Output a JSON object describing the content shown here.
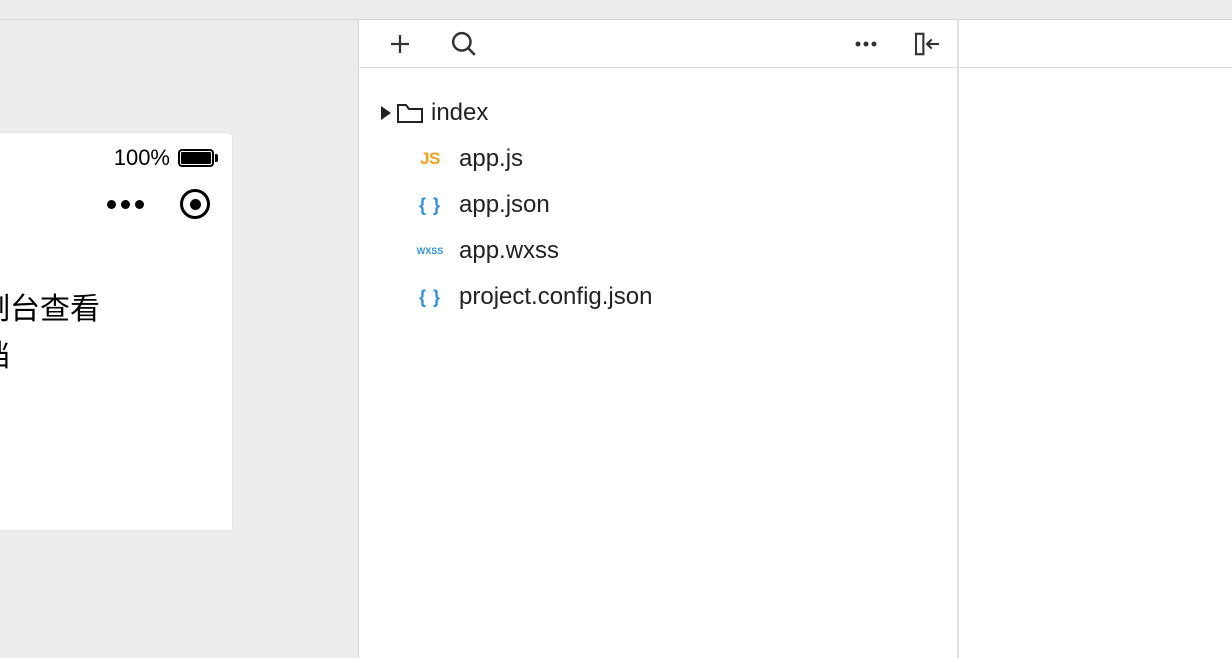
{
  "simulator": {
    "battery_percent": "100%",
    "content_line1": "制台查看",
    "content_line2": "档"
  },
  "explorer": {
    "folder": {
      "name": "index"
    },
    "files": [
      {
        "type": "JS",
        "name": "app.js",
        "type_class": "js-color"
      },
      {
        "type": "{ }",
        "name": "app.json",
        "type_class": "json-color"
      },
      {
        "type": "WXSS",
        "name": "app.wxss",
        "type_class": "wxss-color"
      },
      {
        "type": "{ }",
        "name": "project.config.json",
        "type_class": "json-color"
      }
    ]
  }
}
